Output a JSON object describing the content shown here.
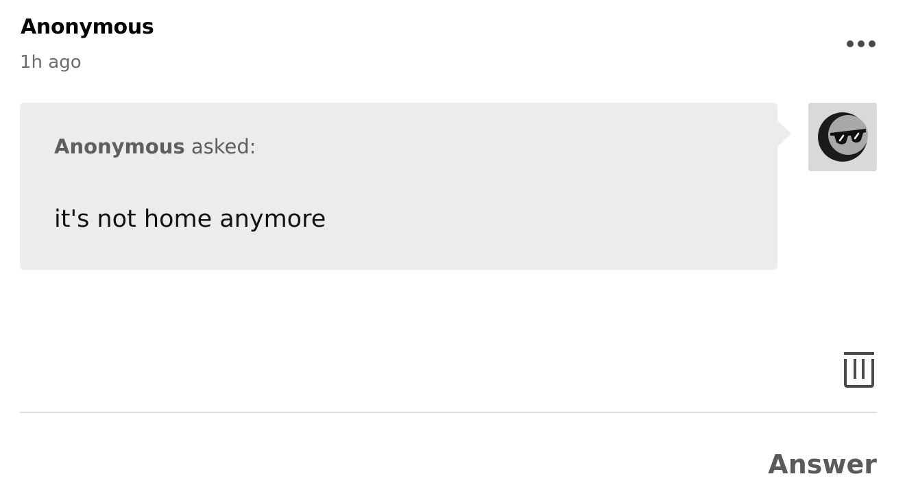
{
  "post": {
    "author": "Anonymous",
    "timestamp": "1h ago"
  },
  "menu": {
    "icon": "more-horizontal-icon"
  },
  "ask": {
    "asker_name": "Anonymous",
    "asked_label": " asked:",
    "question": "it's not home anymore",
    "bubble_color": "#ececec"
  },
  "avatar": {
    "icon": "anonymous-sunglasses-avatar"
  },
  "actions": {
    "delete_icon": "trash-icon",
    "answer_label": "Answer"
  }
}
